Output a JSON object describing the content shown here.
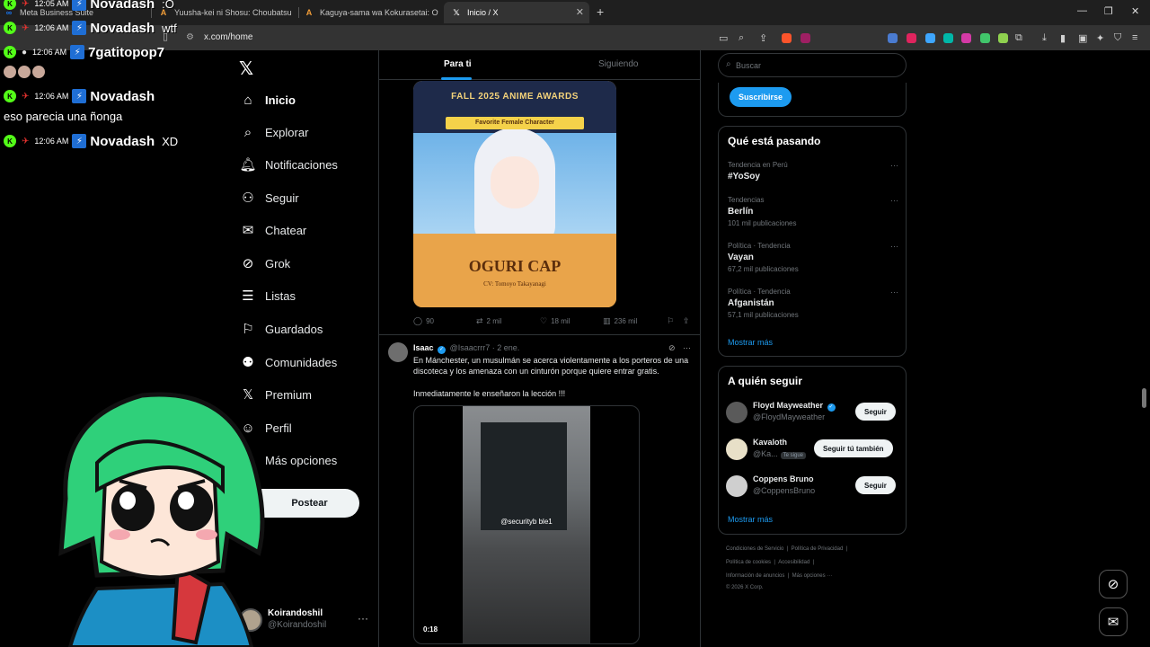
{
  "browser": {
    "tabs": [
      {
        "title": "Meta Business Suite",
        "active": false
      },
      {
        "title": "Yuusha-kei ni Shosu: Choubatsu Yuu",
        "active": false
      },
      {
        "title": "Kaguya-sama wa Kokurasetai: Otona",
        "active": false
      },
      {
        "title": "Inicio / X",
        "active": true
      }
    ],
    "url": "x.com/home"
  },
  "nav": {
    "items": [
      {
        "label": "Inicio",
        "icon": "home-icon",
        "active": true
      },
      {
        "label": "Explorar",
        "icon": "search-icon"
      },
      {
        "label": "Notificaciones",
        "icon": "bell-icon"
      },
      {
        "label": "Seguir",
        "icon": "add-person-icon"
      },
      {
        "label": "Chatear",
        "icon": "mail-icon"
      },
      {
        "label": "Grok",
        "icon": "grok-icon"
      },
      {
        "label": "Listas",
        "icon": "list-icon"
      },
      {
        "label": "Guardados",
        "icon": "bookmark-icon"
      },
      {
        "label": "Comunidades",
        "icon": "people-icon"
      },
      {
        "label": "Premium",
        "icon": "x-logo-icon"
      },
      {
        "label": "Perfil",
        "icon": "person-icon"
      },
      {
        "label": "Más opciones",
        "icon": "more-icon"
      }
    ],
    "post_label": "Postear",
    "account": {
      "name": "Koirandoshil",
      "handle": "@Koirandoshil"
    }
  },
  "feed": {
    "tabs": [
      "Para ti",
      "Siguiendo"
    ],
    "post1": {
      "media": {
        "title": "FALL 2025 ANIME AWARDS",
        "band": "Favorite Female Character",
        "name": "OGURI CAP",
        "cv": "CV: Tomoyo Takayanagi"
      },
      "replies": "90",
      "reposts": "2 mil",
      "likes": "18 mil",
      "views": "236 mil"
    },
    "post2": {
      "name": "Isaac",
      "handle": "@Isaacrrr7",
      "date": "· 2 ene.",
      "text": "En Mánchester, un musulmán se acerca violentamente a los porteros de una discoteca y los amenaza con un cinturón porque quiere entrar gratis.",
      "text2": "Inmediatamente le enseñaron la lección !!!",
      "video_caption": "@securityb ble1",
      "video_time": "0:18"
    }
  },
  "right": {
    "search_placeholder": "Buscar",
    "subscribe_label": "Suscribirse",
    "trending_title": "Qué está pasando",
    "trends": [
      {
        "context": "Tendencia en Perú",
        "topic": "#YoSoy",
        "count": ""
      },
      {
        "context": "Tendencias",
        "topic": "Berlín",
        "count": "101 mil publicaciones"
      },
      {
        "context": "Política · Tendencia",
        "topic": "Vayan",
        "count": "67,2 mil publicaciones"
      },
      {
        "context": "Política · Tendencia",
        "topic": "Afganistán",
        "count": "57,1 mil publicaciones"
      }
    ],
    "show_more": "Mostrar más",
    "follow_title": "A quién seguir",
    "follow": [
      {
        "name": "Floyd Mayweather",
        "handle": "@FloydMayweather",
        "button": "Seguir",
        "badge": ""
      },
      {
        "name": "Kavaloth",
        "handle": "@Ka...",
        "button": "Seguir tú también",
        "badge": "Te sigue"
      },
      {
        "name": "Coppens Bruno",
        "handle": "@CoppensBruno",
        "button": "Seguir",
        "badge": ""
      }
    ],
    "footer": [
      [
        "Condiciones de Servicio",
        "Política de Privacidad"
      ],
      [
        "Política de cookies",
        "Accesibilidad"
      ],
      [
        "Información de anuncios",
        "Más opciones ···"
      ],
      [
        "© 2026 X Corp."
      ]
    ]
  },
  "chat": {
    "rows": [
      {
        "time": "12:05 AM",
        "user": "Novadash",
        "msg": ":O"
      },
      {
        "time": "12:06 AM",
        "user": "Novadash",
        "msg": "wtf"
      },
      {
        "time": "12:06 AM",
        "user": "7gatitopop7",
        "msg": ""
      },
      {
        "time": "12:06 AM",
        "user": "Novadash",
        "msg": ""
      },
      {
        "time": "12:06 AM",
        "user": "Novadash",
        "msg": "XD"
      }
    ],
    "message_line": "eso parecia una ñonga"
  },
  "colors": {
    "accent": "#1d9bf0",
    "kick_green": "#53fc18",
    "background": "#000000"
  }
}
